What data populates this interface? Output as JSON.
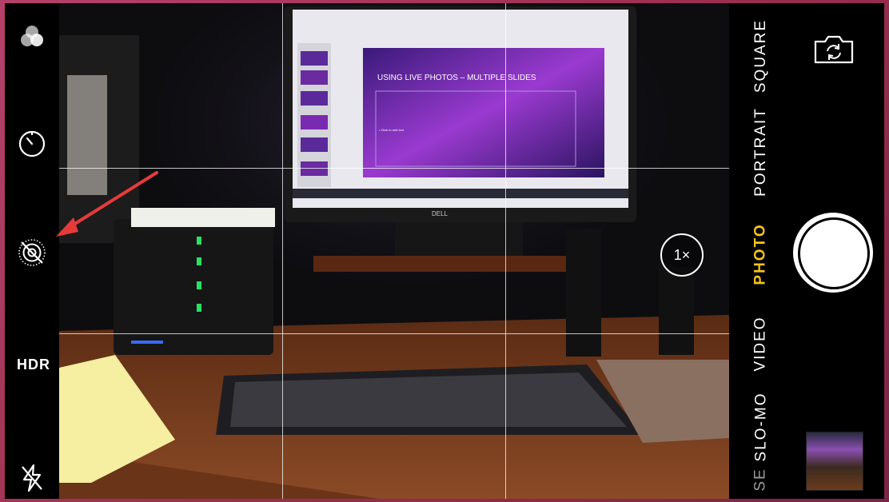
{
  "camera": {
    "left_controls": {
      "filters_icon": "filters-icon",
      "timer_icon": "timer-icon",
      "live_photo_icon": "live-photo-off-icon",
      "hdr_label": "HDR",
      "flash_icon": "flash-off-icon"
    },
    "modes": [
      {
        "label": "SQUARE",
        "active": false
      },
      {
        "label": "PORTRAIT",
        "active": false
      },
      {
        "label": "PHOTO",
        "active": true
      },
      {
        "label": "VIDEO",
        "active": false
      },
      {
        "label": "SLO-MO",
        "active": false
      },
      {
        "label": "SE",
        "active": false
      }
    ],
    "zoom_label": "1×",
    "accent_color": "#f5c518",
    "annotation_arrow_color": "#e83a3a"
  },
  "scene": {
    "monitor_slide_title": "USING LIVE PHOTOS – MULTIPLE SLIDES",
    "monitor_slide_bullet": "• Click to add text",
    "monitor_brand": "DELL"
  }
}
